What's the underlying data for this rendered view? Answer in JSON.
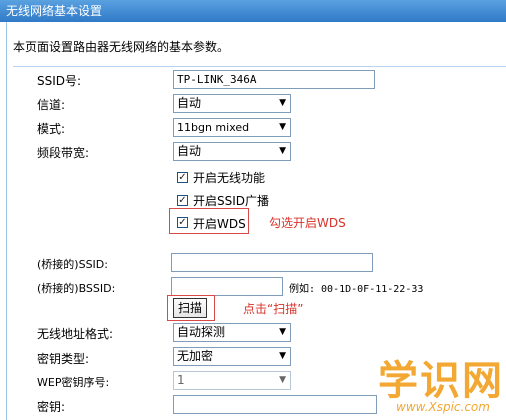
{
  "title": "无线网络基本设置",
  "intro": "本页面设置路由器无线网络的基本参数。",
  "fields": {
    "ssid": {
      "label": "SSID号:",
      "value": "TP-LINK_346A"
    },
    "channel": {
      "label": "信道:",
      "value": "自动"
    },
    "mode": {
      "label": "模式:",
      "value": "11bgn mixed"
    },
    "bandwidth": {
      "label": "频段带宽:",
      "value": "自动"
    }
  },
  "checkboxes": {
    "enable_wireless": {
      "label": "开启无线功能",
      "checked": true
    },
    "enable_ssid_broadcast": {
      "label": "开启SSID广播",
      "checked": true
    },
    "enable_wds": {
      "label": "开启WDS",
      "checked": true
    }
  },
  "annotations": {
    "wds_hint": "勾选开启WDS",
    "scan_hint": "点击“扫描”"
  },
  "wds": {
    "bridged_ssid": {
      "label": "(桥接的)SSID:",
      "value": ""
    },
    "bridged_bssid": {
      "label": "(桥接的)BSSID:",
      "value": "",
      "example": "例如: 00-1D-0F-11-22-33"
    },
    "scan_button": "扫描",
    "addr_format": {
      "label": "无线地址格式:",
      "value": "自动探测"
    },
    "key_type": {
      "label": "密钥类型:",
      "value": "无加密"
    },
    "wep_index": {
      "label": "WEP密钥序号:",
      "value": "1"
    },
    "key": {
      "label": "密钥:",
      "value": ""
    }
  },
  "watermark": {
    "big": "学识网",
    "small": "www.Xspic.com"
  },
  "colors": {
    "title_bar": "#2f7ac8",
    "annotation": "#d8322a",
    "watermark": "#f2a832"
  }
}
